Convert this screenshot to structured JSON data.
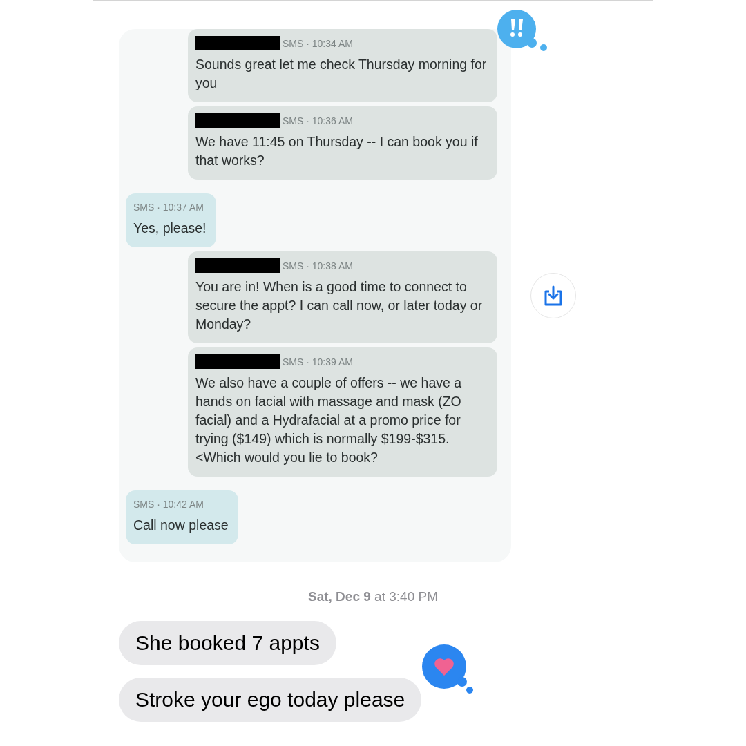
{
  "sms_screenshot": {
    "messages": [
      {
        "kind": "staff",
        "meta": "SMS · 10:34 AM",
        "text": "Sounds great let me check Thursday morning for you"
      },
      {
        "kind": "staff",
        "meta": "SMS · 10:36 AM",
        "text": "We have 11:45 on Thursday -- I can book you if that works?"
      },
      {
        "kind": "client",
        "meta": "SMS · 10:37 AM",
        "text": "Yes, please!"
      },
      {
        "kind": "staff",
        "meta": "SMS · 10:38 AM",
        "text": "You are in! When is a good time to connect to secure the appt? I can call now, or later today or Monday?"
      },
      {
        "kind": "staff",
        "meta": "SMS · 10:39 AM",
        "text": "We also have a couple of offers -- we have a hands on facial with massage and mask (ZO facial) and a Hydrafacial at a promo price for trying ($149) which is normally $199-$315. <Which would you lie to book?"
      },
      {
        "kind": "client",
        "meta": "SMS · 10:42 AM",
        "text": "Call now please"
      }
    ]
  },
  "date_stamp": "**Sat, Dec 9** at 3:40 PM",
  "imessages": [
    {
      "text": "She booked 7 appts"
    },
    {
      "text": "Stroke your ego today please"
    }
  ]
}
